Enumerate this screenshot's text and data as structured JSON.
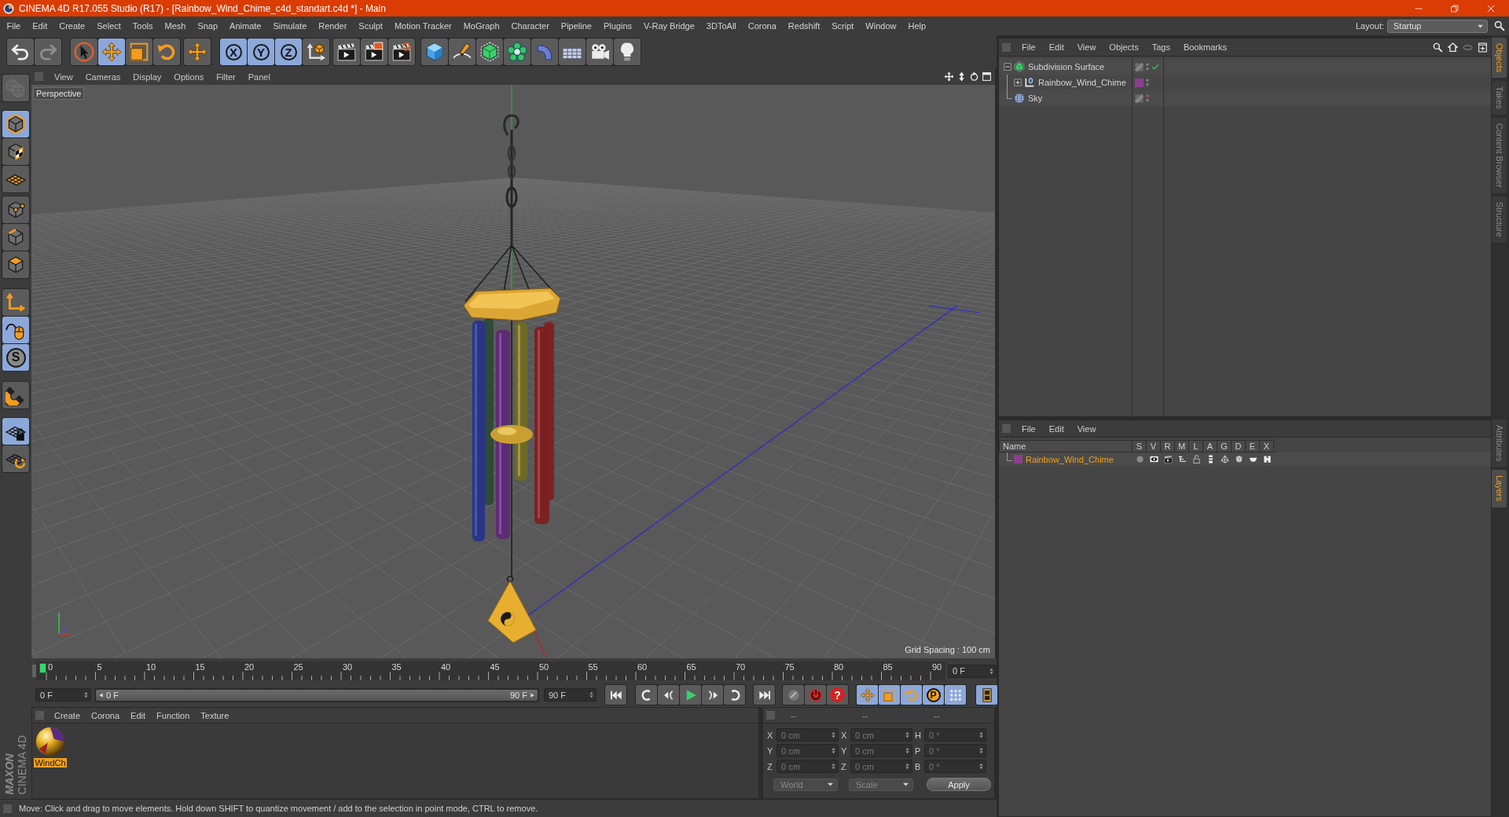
{
  "window": {
    "title": "CINEMA 4D R17.055 Studio (R17) - [Rainbow_Wind_Chime_c4d_standart.c4d *] - Main"
  },
  "menu_bar": {
    "items": [
      "File",
      "Edit",
      "Create",
      "Select",
      "Tools",
      "Mesh",
      "Snap",
      "Animate",
      "Simulate",
      "Render",
      "Sculpt",
      "Motion Tracker",
      "MoGraph",
      "Character",
      "Pipeline",
      "Plugins",
      "V-Ray Bridge",
      "3DToAll",
      "Corona",
      "Redshift",
      "Script",
      "Window",
      "Help"
    ],
    "layout_label": "Layout:",
    "layout_value": "Startup"
  },
  "toolbar": {
    "history": [
      {
        "disabled": false
      },
      {
        "disabled": true
      }
    ],
    "tools": [
      {
        "selected": false
      },
      {
        "selected": true
      },
      {
        "selected": false
      },
      {
        "selected": false
      }
    ],
    "axes": [
      {
        "label": "X",
        "on": true
      },
      {
        "label": "Y",
        "on": true
      },
      {
        "label": "Z",
        "on": true
      }
    ]
  },
  "left_toolbar": [
    {
      "on": false,
      "disabled": true
    },
    {
      "on": true,
      "disabled": false
    },
    {
      "on": false,
      "disabled": false
    },
    {
      "on": false,
      "disabled": false
    },
    {
      "on": false,
      "disabled": false
    },
    {
      "on": false,
      "disabled": false
    },
    {
      "on": false,
      "disabled": false
    },
    {
      "on": false,
      "disabled": false
    },
    {
      "on": true,
      "disabled": false
    },
    {
      "label": "S",
      "on": true,
      "disabled": false
    },
    {
      "on": false,
      "disabled": false
    },
    {
      "on": true,
      "disabled": false
    },
    {
      "on": false,
      "disabled": false
    }
  ],
  "viewport": {
    "menu": [
      "View",
      "Cameras",
      "Display",
      "Options",
      "Filter",
      "Panel"
    ],
    "camera": "Perspective",
    "grid_spacing": "Grid Spacing : 100 cm"
  },
  "timeline": {
    "ticks": [
      "0",
      "5",
      "10",
      "15",
      "20",
      "25",
      "30",
      "35",
      "40",
      "45",
      "50",
      "55",
      "60",
      "65",
      "70",
      "75",
      "80",
      "85",
      "90"
    ],
    "level": 0,
    "frame": "0 F"
  },
  "playback": {
    "start": "0 F",
    "range": {
      "start_label": "0 F",
      "end_label": "90 F",
      "level": 1
    },
    "end": "90 F",
    "record_label": "?",
    "key_modes": [
      {
        "on": true
      },
      {
        "on": true
      },
      {
        "on": true
      },
      {
        "label": "P",
        "on": true
      },
      {
        "on": true
      }
    ],
    "timeline_view": {
      "on": true
    }
  },
  "material_manager": {
    "menu": [
      "Create",
      "Corona",
      "Edit",
      "Function",
      "Texture"
    ],
    "materials": [
      {
        "name": "WindCh",
        "selected": true
      }
    ]
  },
  "coordinates": {
    "disabled": true,
    "headers": [
      "--",
      "--",
      "--"
    ],
    "rows": [
      {
        "position_axis": "X",
        "position": "0 cm",
        "size_axis": "X",
        "size": "0 cm",
        "rotation_axis": "H",
        "rotation": "0 °"
      },
      {
        "position_axis": "Y",
        "position": "0 cm",
        "size_axis": "Y",
        "size": "0 cm",
        "rotation_axis": "P",
        "rotation": "0 °"
      },
      {
        "position_axis": "Z",
        "position": "0 cm",
        "size_axis": "Z",
        "size": "0 cm",
        "rotation_axis": "B",
        "rotation": "0 °"
      }
    ],
    "space": "World",
    "mode": "Scale",
    "apply": "Apply"
  },
  "logo": {
    "brand": "MAXON",
    "product": "CINEMA 4D"
  },
  "status_bar": {
    "text": "Move: Click and drag to move elements. Hold down SHIFT to quantize movement / add to the selection in point mode, CTRL to remove."
  },
  "object_manager": {
    "menu": [
      "File",
      "Edit",
      "View",
      "Objects",
      "Tags",
      "Bookmarks"
    ],
    "objects": [
      {
        "name": "Subdivision Surface",
        "kind": "subdivision",
        "expanded": true,
        "enabled": true,
        "hidden_in_editor": false,
        "children": [
          {
            "name": "Rainbow_Wind_Chime",
            "kind": "null",
            "expanded": false,
            "color": "#8c3f8c",
            "hidden_in_editor": false
          }
        ]
      },
      {
        "name": "Sky",
        "kind": "sky",
        "hidden_in_editor": true
      }
    ]
  },
  "layer_manager": {
    "menu": [
      "File",
      "Edit",
      "View"
    ],
    "columns": [
      "Name",
      "S",
      "V",
      "R",
      "M",
      "L",
      "A",
      "G",
      "D",
      "E",
      "X"
    ],
    "layers": [
      {
        "name": "Rainbow_Wind_Chime",
        "color": "#8c3f8c",
        "selected": true,
        "flags": [
          {
            "on": false
          },
          {
            "on": true
          },
          {
            "on": true
          },
          {
            "on": true
          },
          {
            "on": false
          },
          {
            "on": true
          },
          {
            "on": true
          },
          {
            "on": true
          },
          {
            "on": true
          },
          {
            "on": true
          }
        ]
      }
    ]
  },
  "side_tabs": {
    "upper": [
      {
        "label": "Objects",
        "selected": true
      },
      {
        "label": "Takes",
        "selected": false
      },
      {
        "label": "Content Browser",
        "selected": false
      },
      {
        "label": "Structure",
        "selected": false
      }
    ],
    "lower": [
      {
        "label": "Attributes",
        "selected": false
      },
      {
        "label": "Layers",
        "selected": true
      }
    ]
  }
}
